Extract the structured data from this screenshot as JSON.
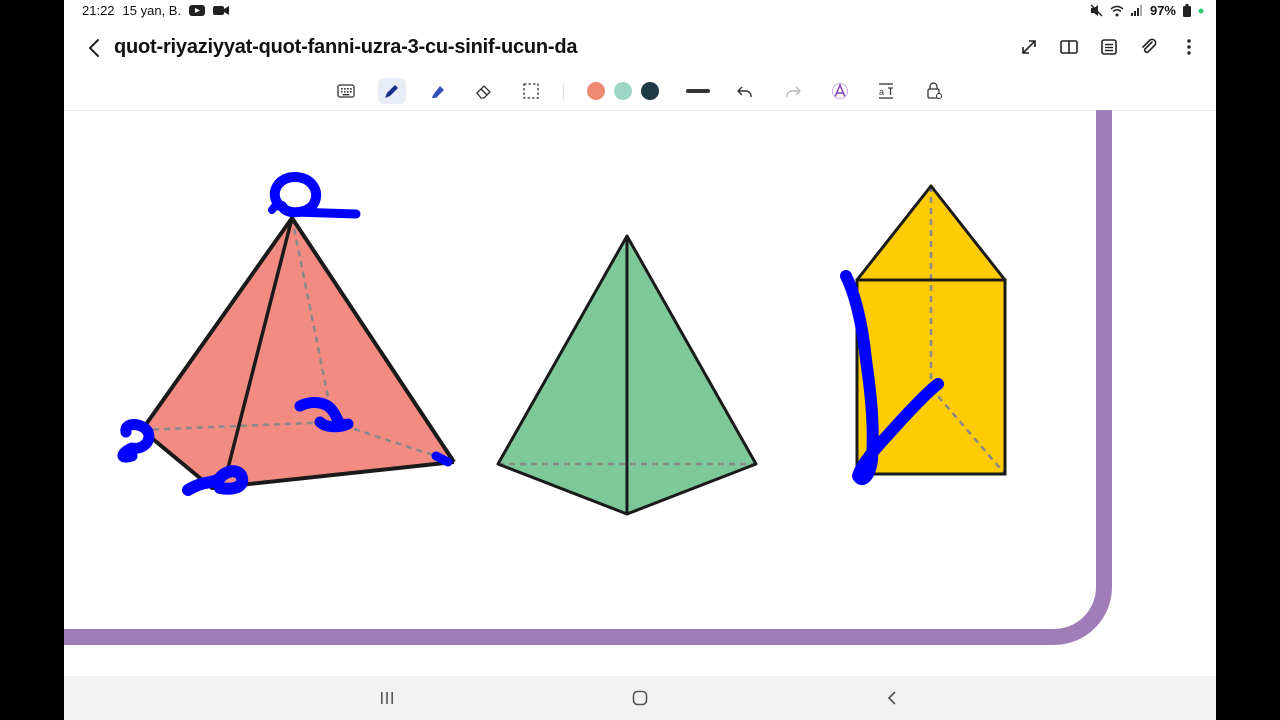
{
  "status_bar": {
    "time": "21:22",
    "date": "15 yan, B.",
    "battery": "97%",
    "icons": [
      "youtube-icon",
      "video-call-icon",
      "mute-icon",
      "wifi-icon",
      "signal-icon",
      "battery-icon"
    ]
  },
  "header": {
    "title": "quot-riyaziyyat-quot-fanni-uzra-3-cu-sinif-ucun-da",
    "back_icon": "back-arrow-icon",
    "actions": [
      "expand-icon",
      "book-view-icon",
      "list-icon",
      "attach-icon",
      "more-vert-icon"
    ]
  },
  "toolbar": {
    "tools": [
      "keyboard-icon",
      "pen-icon",
      "highlighter-icon",
      "eraser-icon",
      "lasso-select-icon",
      "stroke-width-icon",
      "undo-icon",
      "redo-icon",
      "text-style-icon",
      "text-convert-icon",
      "lock-icon"
    ],
    "active_tool": "pen-icon",
    "colors": [
      "#f08a75",
      "#9ed6c5",
      "#1e3a44"
    ]
  },
  "canvas": {
    "frame_color": "#a07db7",
    "ink_color": "#0000ff",
    "shapes": [
      {
        "name": "square-pyramid",
        "fill": "#f28b82"
      },
      {
        "name": "triangular-pyramid",
        "fill": "#7ec99a"
      },
      {
        "name": "triangular-prism",
        "fill": "#ffcb05"
      }
    ]
  },
  "nav_bar": {
    "buttons": [
      "recent-apps-icon",
      "home-icon",
      "back-icon"
    ]
  }
}
